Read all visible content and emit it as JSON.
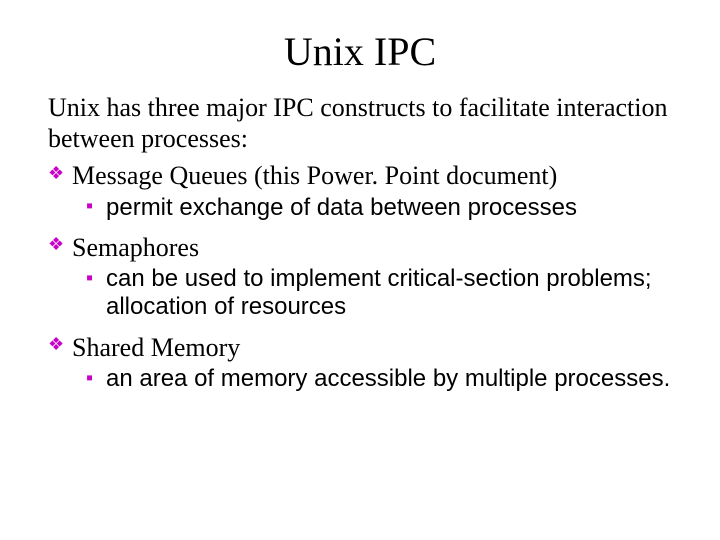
{
  "title": "Unix IPC",
  "intro": "Unix has three major IPC constructs to facilitate interaction between processes:",
  "items": [
    {
      "heading": "Message Queues (this Power. Point document)",
      "sub": "permit exchange of data between processes"
    },
    {
      "heading": "Semaphores",
      "sub": "can be used to implement critical-section problems; allocation of resources"
    },
    {
      "heading": "Shared Memory",
      "sub": "an area of memory accessible by multiple processes."
    }
  ]
}
